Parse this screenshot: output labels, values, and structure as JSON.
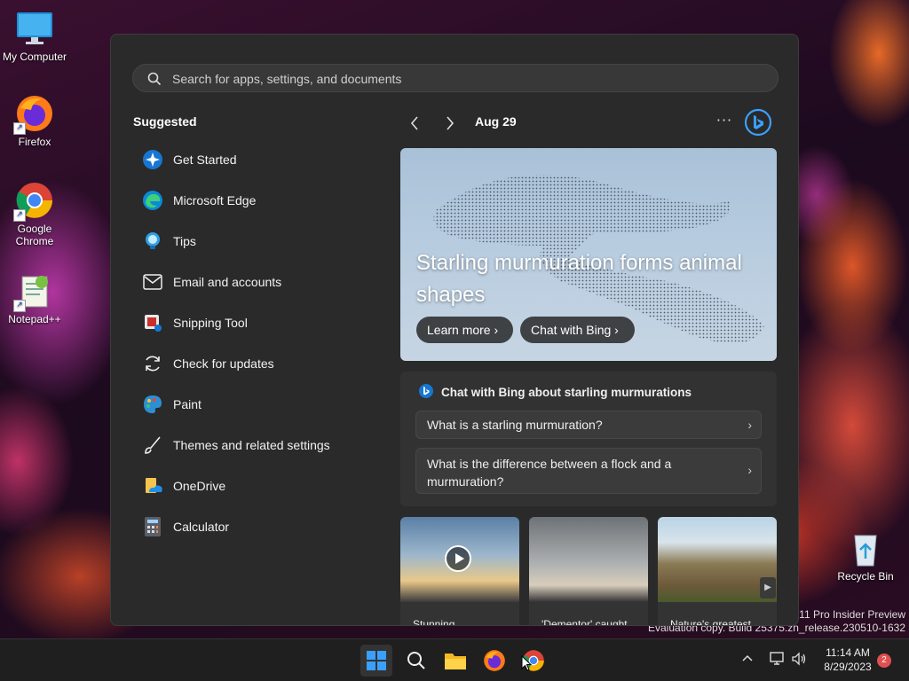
{
  "desktop": {
    "icons": [
      {
        "label": "My Computer",
        "icon": "monitor-icon"
      },
      {
        "label": "Firefox",
        "icon": "firefox-icon"
      },
      {
        "label": "Google Chrome",
        "icon": "chrome-icon"
      },
      {
        "label": "Notepad++",
        "icon": "notepadpp-icon"
      },
      {
        "label": "Recycle Bin",
        "icon": "recycle-bin-icon"
      }
    ],
    "watermark": {
      "line1": "s 11 Pro Insider Preview",
      "line2": "Evaluation copy. Build 25375.zn_release.230510-1632"
    }
  },
  "start_menu": {
    "search": {
      "placeholder": "Search for apps, settings, and documents",
      "value": ""
    },
    "suggested": {
      "title": "Suggested",
      "items": [
        {
          "label": "Get Started",
          "icon": "get-started-icon"
        },
        {
          "label": "Microsoft Edge",
          "icon": "edge-icon"
        },
        {
          "label": "Tips",
          "icon": "tips-icon"
        },
        {
          "label": "Email and accounts",
          "icon": "mail-icon"
        },
        {
          "label": "Snipping Tool",
          "icon": "snipping-tool-icon"
        },
        {
          "label": "Check for updates",
          "icon": "refresh-icon"
        },
        {
          "label": "Paint",
          "icon": "paint-icon"
        },
        {
          "label": "Themes and related settings",
          "icon": "brush-icon"
        },
        {
          "label": "OneDrive",
          "icon": "onedrive-icon"
        },
        {
          "label": "Calculator",
          "icon": "calculator-icon"
        }
      ]
    },
    "news": {
      "date": "Aug 29",
      "more_label": "···",
      "hero": {
        "title": "Starling murmuration forms animal shapes",
        "learn_more": "Learn more ›",
        "chat_with_bing": "Chat with Bing ›"
      },
      "chat_card": {
        "title": "Chat with Bing about starling murmurations",
        "questions": [
          "What is a starling murmuration?",
          "What is the difference between a flock and a murmuration?"
        ]
      },
      "thumbnails": [
        {
          "caption": "Stunning"
        },
        {
          "caption": "'Dementor' caught"
        },
        {
          "caption": "Nature's greatest"
        }
      ]
    }
  },
  "taskbar": {
    "apps": [
      "start-icon",
      "search-icon",
      "file-explorer-icon",
      "firefox-icon",
      "chrome-icon"
    ],
    "clock": {
      "time": "11:14 AM",
      "date": "8/29/2023"
    },
    "notification_count": "2"
  },
  "colors": {
    "accent": "#0078d4",
    "start_bg": "#2a2a2a",
    "taskbar_bg": "#1f1f1f"
  }
}
